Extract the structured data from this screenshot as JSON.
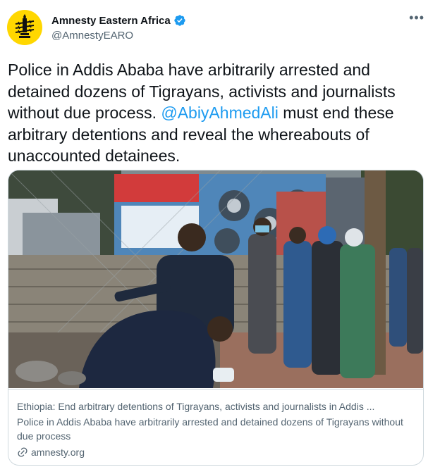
{
  "account": {
    "name": "Amnesty Eastern Africa",
    "handle": "@AmnestyEARO"
  },
  "tweet": {
    "text_before": "Police in Addis Ababa have arbitrarily arrested and detained dozens of Tigrayans, activists and journalists without due process. ",
    "mention": "@AbiyAhmedAli",
    "text_after": " must end these arbitrary detentions and reveal the whereabouts of unaccounted detainees."
  },
  "link_card": {
    "title": "Ethiopia: End arbitrary detentions of Tigrayans, activists and journalists in Addis ...",
    "description": "Police in Addis Ababa have arbitrarily arrested and detained dozens of Tigrayans without due process",
    "domain": "amnesty.org"
  },
  "colors": {
    "accent": "#1d9bf0",
    "avatar_bg": "#ffd700",
    "secondary_text": "#536471",
    "border": "#cfd9de"
  },
  "icons": {
    "avatar": "amnesty-candle-logo",
    "verified": "verified-badge-icon",
    "more": "more-icon",
    "link": "link-icon"
  }
}
